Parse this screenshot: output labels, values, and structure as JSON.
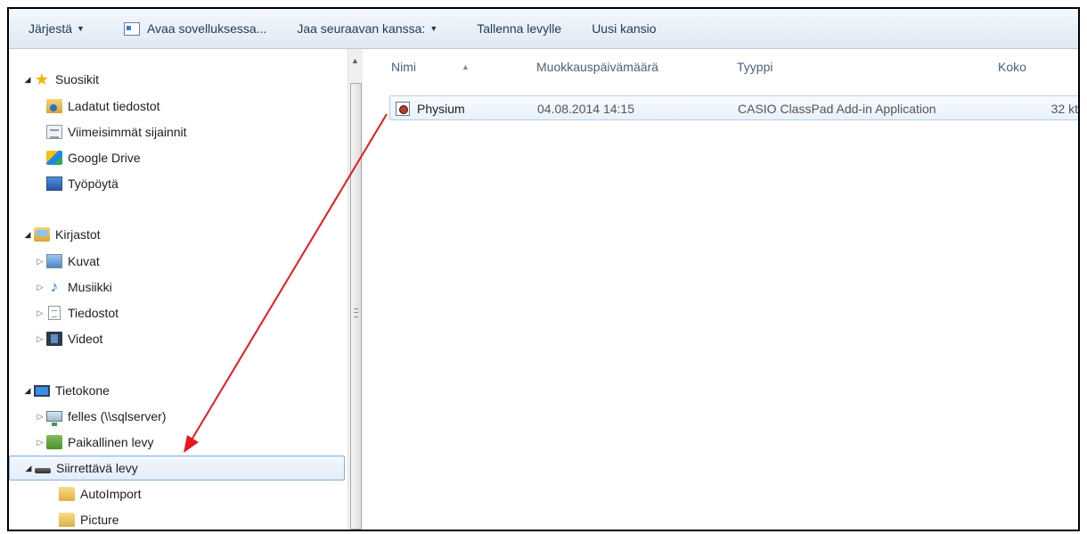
{
  "toolbar": {
    "organize": "Järjestä",
    "open_with": "Avaa sovelluksessa...",
    "share_with": "Jaa seuraavan kanssa:",
    "burn": "Tallenna levylle",
    "new_folder": "Uusi kansio"
  },
  "nav": {
    "favorites": "Suosikit",
    "downloads": "Ladatut tiedostot",
    "recent": "Viimeisimmät sijainnit",
    "google_drive": "Google Drive",
    "desktop": "Työpöytä",
    "libraries": "Kirjastot",
    "pictures": "Kuvat",
    "music": "Musiikki",
    "documents": "Tiedostot",
    "videos": "Videot",
    "computer": "Tietokone",
    "network_drive": "felles (\\\\sqlserver)",
    "local_disk": "Paikallinen levy",
    "removable": "Siirrettävä levy",
    "folder_autoimport": "AutoImport",
    "folder_picture": "Picture"
  },
  "columns": {
    "name": "Nimi",
    "modified": "Muokkauspäivämäärä",
    "type": "Tyyppi",
    "size": "Koko"
  },
  "file": {
    "name": "Physium",
    "modified": "04.08.2014 14:15",
    "type": "CASIO ClassPad Add-in Application",
    "size": "32 kt"
  },
  "colors": {
    "annotation_arrow": "#e8191e",
    "selection_border": "#84acdd"
  }
}
